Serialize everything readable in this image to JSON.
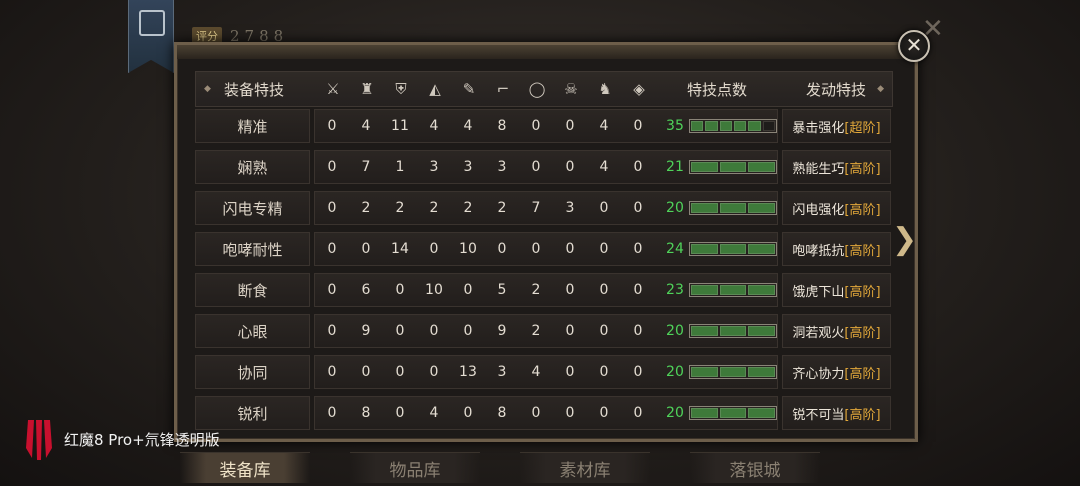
{
  "score": {
    "label": "评分",
    "value": "2788"
  },
  "header": {
    "name": "装备特技",
    "icons": [
      "sword-icon",
      "helmet-icon",
      "armor-icon",
      "shoulder-icon",
      "bracer-icon",
      "boots-icon",
      "ring-icon",
      "demon-mask-icon",
      "horse-icon",
      "gem-icon"
    ],
    "points": "特技点数",
    "skill": "发动特技"
  },
  "rows": [
    {
      "name": "精准",
      "values": [
        "0",
        "4",
        "11",
        "4",
        "4",
        "8",
        "0",
        "0",
        "4",
        "0"
      ],
      "points": "35",
      "filled": 5,
      "total": 6,
      "skill": "暴击强化",
      "tier": "[超阶]"
    },
    {
      "name": "娴熟",
      "values": [
        "0",
        "7",
        "1",
        "3",
        "3",
        "3",
        "0",
        "0",
        "4",
        "0"
      ],
      "points": "21",
      "filled": 3,
      "total": 3,
      "skill": "熟能生巧",
      "tier": "[高阶]"
    },
    {
      "name": "闪电专精",
      "values": [
        "0",
        "2",
        "2",
        "2",
        "2",
        "2",
        "7",
        "3",
        "0",
        "0"
      ],
      "points": "20",
      "filled": 3,
      "total": 3,
      "skill": "闪电强化",
      "tier": "[高阶]"
    },
    {
      "name": "咆哮耐性",
      "values": [
        "0",
        "0",
        "14",
        "0",
        "10",
        "0",
        "0",
        "0",
        "0",
        "0"
      ],
      "points": "24",
      "filled": 3,
      "total": 3,
      "skill": "咆哮抵抗",
      "tier": "[高阶]"
    },
    {
      "name": "断食",
      "values": [
        "0",
        "6",
        "0",
        "10",
        "0",
        "5",
        "2",
        "0",
        "0",
        "0"
      ],
      "points": "23",
      "filled": 3,
      "total": 3,
      "skill": "饿虎下山",
      "tier": "[高阶]"
    },
    {
      "name": "心眼",
      "values": [
        "0",
        "9",
        "0",
        "0",
        "0",
        "9",
        "2",
        "0",
        "0",
        "0"
      ],
      "points": "20",
      "filled": 3,
      "total": 3,
      "skill": "洞若观火",
      "tier": "[高阶]"
    },
    {
      "name": "协同",
      "values": [
        "0",
        "0",
        "0",
        "0",
        "13",
        "3",
        "4",
        "0",
        "0",
        "0"
      ],
      "points": "20",
      "filled": 3,
      "total": 3,
      "skill": "齐心协力",
      "tier": "[高阶]"
    },
    {
      "name": "锐利",
      "values": [
        "0",
        "8",
        "0",
        "4",
        "0",
        "8",
        "0",
        "0",
        "0",
        "0"
      ],
      "points": "20",
      "filled": 3,
      "total": 3,
      "skill": "锐不可当",
      "tier": "[高阶]"
    }
  ],
  "tabs": [
    "装备库",
    "物品库",
    "素材库",
    "落银城"
  ],
  "watermark": "红魔8 Pro+氘锋透明版",
  "colors": {
    "points_green": "#4fd35a",
    "tier_gold": "#e2a83a",
    "bar_fill": "#3e7a3a"
  }
}
